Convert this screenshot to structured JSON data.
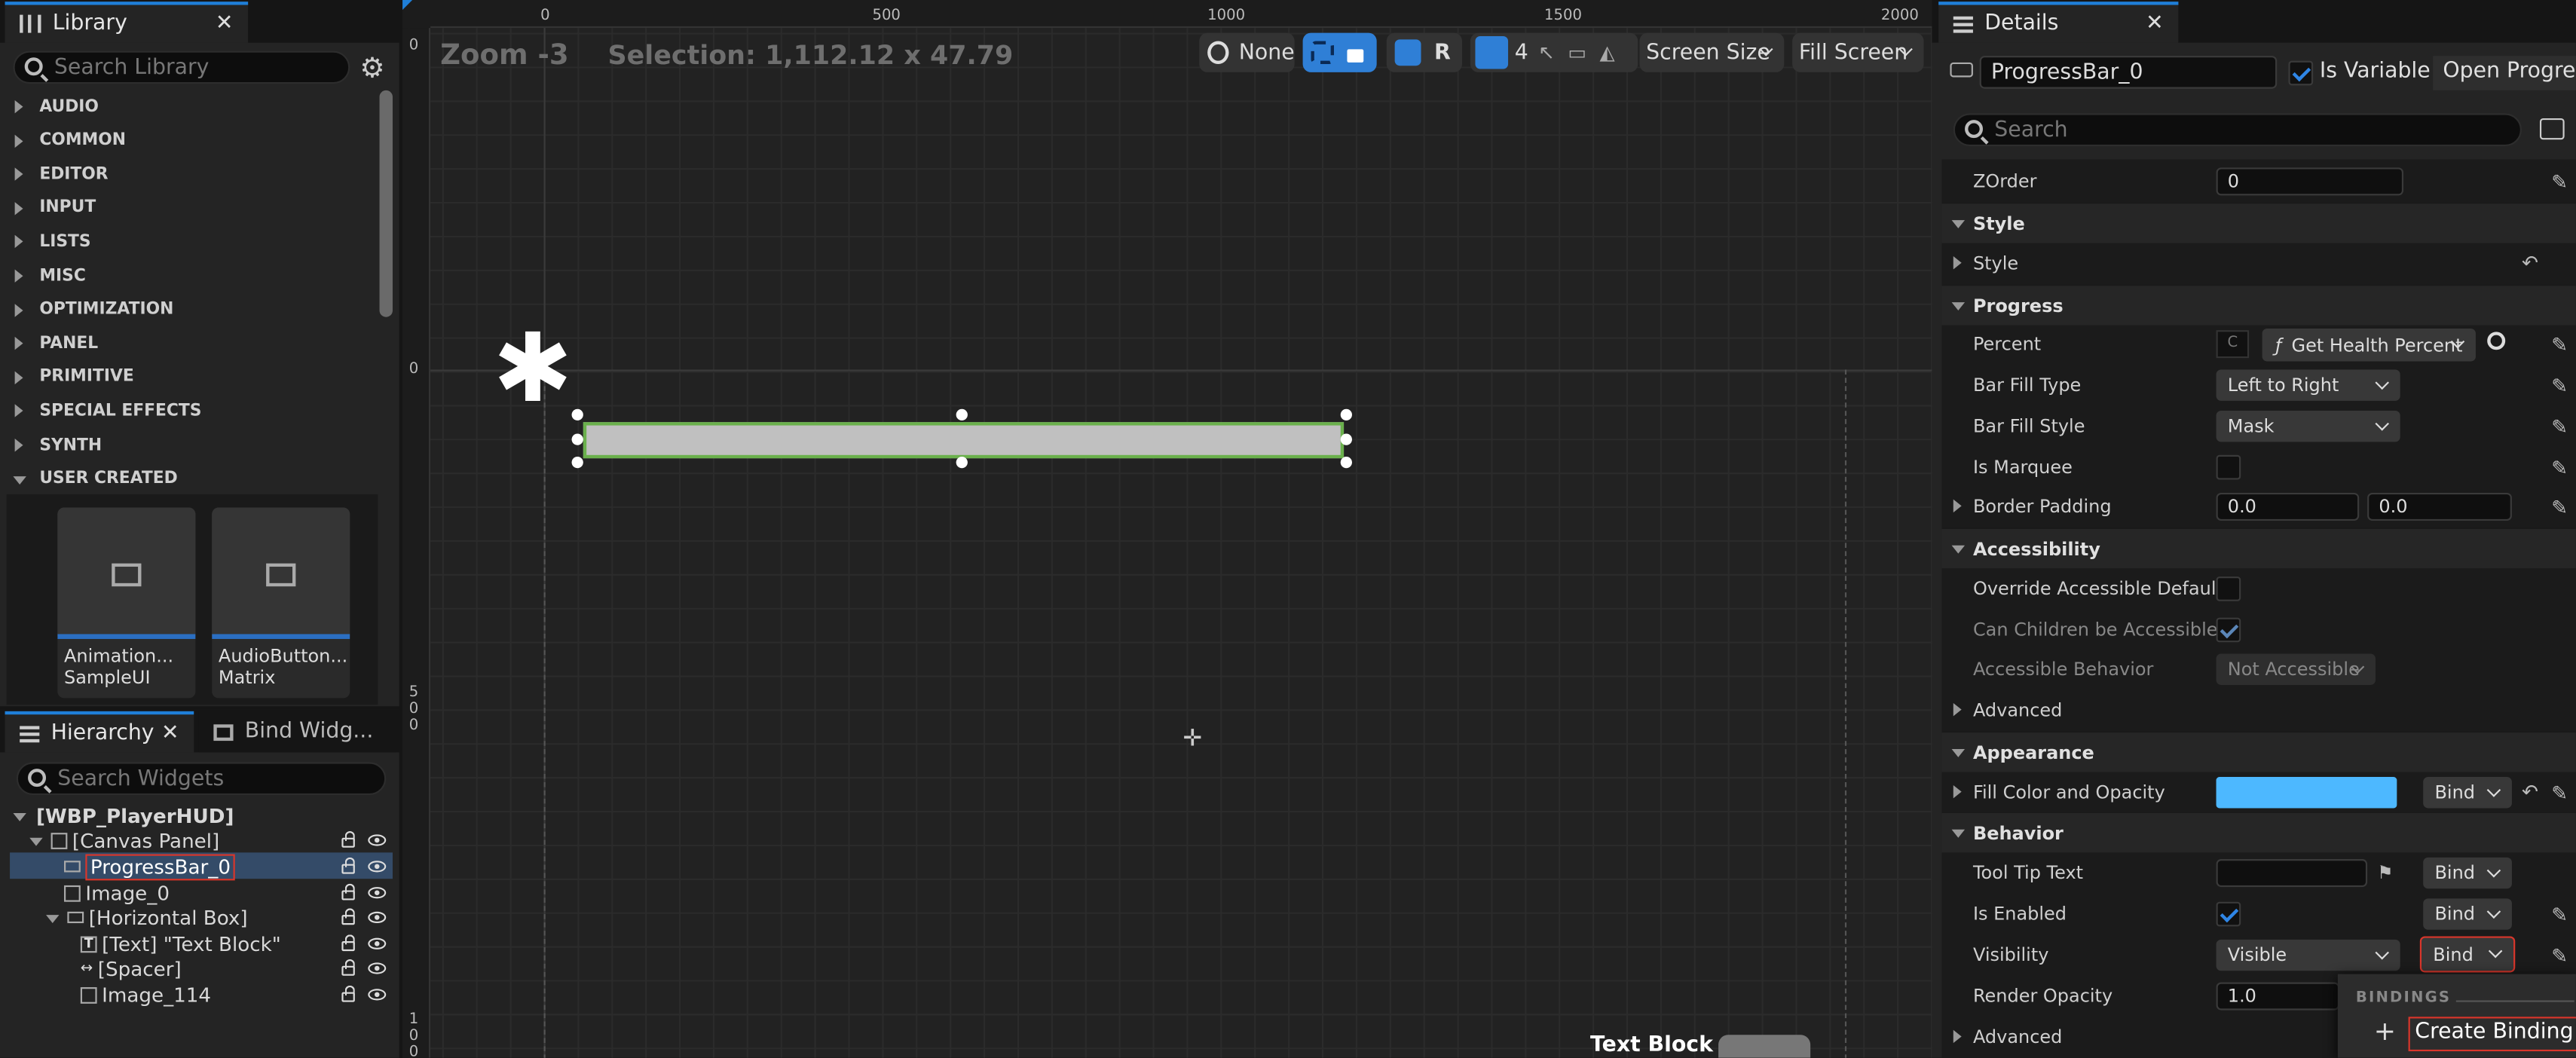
{
  "library": {
    "tab_title": "Library",
    "search_placeholder": "Search Library",
    "categories": [
      "AUDIO",
      "COMMON",
      "EDITOR",
      "INPUT",
      "LISTS",
      "MISC",
      "OPTIMIZATION",
      "PANEL",
      "PRIMITIVE",
      "SPECIAL EFFECTS",
      "SYNTH",
      "USER CREATED"
    ],
    "tiles": [
      {
        "line1": "Animation...",
        "line2": "SampleUI"
      },
      {
        "line1": "AudioButton...",
        "line2": "Matrix"
      }
    ]
  },
  "hierarchy": {
    "tab_title": "Hierarchy",
    "other_tab": "Bind Widg...",
    "search_placeholder": "Search Widgets",
    "items": [
      {
        "label": "[WBP_PlayerHUD]"
      },
      {
        "label": "[Canvas Panel]"
      },
      {
        "label": "ProgressBar_0"
      },
      {
        "label": "Image_0"
      },
      {
        "label": "[Horizontal Box]"
      },
      {
        "label": "[Text] \"Text Block\""
      },
      {
        "label": "[Spacer]"
      },
      {
        "label": "Image_114"
      }
    ]
  },
  "viewport": {
    "zoom": "Zoom -3",
    "selection": "Selection: 1,112.12 x 47.79",
    "toolbar": {
      "none": "None",
      "r": "R",
      "grid_count": "4",
      "screen_size": "Screen Size",
      "fill_screen": "Fill Screen"
    },
    "ruler_top": [
      "0",
      "500",
      "1000",
      "1500",
      "2000"
    ],
    "ruler_left_0": "0",
    "ruler_left_0b": "0",
    "ruler_left_500": [
      "5",
      "0",
      "0"
    ],
    "ruler_left_1000": [
      "1",
      "0",
      "0"
    ],
    "text_block": "Text Block"
  },
  "details": {
    "tab_title": "Details",
    "name": "ProgressBar_0",
    "is_variable": "Is Variable",
    "open_button": "Open Progress",
    "search_placeholder": "Search",
    "zorder_label": "ZOrder",
    "zorder_value": "0",
    "style_section": "Style",
    "style_label": "Style",
    "progress_section": "Progress",
    "percent_label": "Percent",
    "percent_binding": "Get Health Percent",
    "bar_fill_type_label": "Bar Fill Type",
    "bar_fill_type_value": "Left to Right",
    "bar_fill_style_label": "Bar Fill Style",
    "bar_fill_style_value": "Mask",
    "is_marquee_label": "Is Marquee",
    "border_padding_label": "Border Padding",
    "border_padding_x": "0.0",
    "border_padding_y": "0.0",
    "accessibility_section": "Accessibility",
    "override_label": "Override Accessible Defaults",
    "can_children_label": "Can Children be Accessible",
    "accessible_behavior_label": "Accessible Behavior",
    "accessible_behavior_value": "Not Accessible",
    "advanced_label": "Advanced",
    "appearance_section": "Appearance",
    "fill_color_label": "Fill Color and Opacity",
    "fill_color": "#4db8ff",
    "behavior_section": "Behavior",
    "tooltip_label": "Tool Tip Text",
    "is_enabled_label": "Is Enabled",
    "visibility_label": "Visibility",
    "visibility_value": "Visible",
    "render_opacity_label": "Render Opacity",
    "render_opacity_value": "1.0",
    "bind_label": "Bind",
    "bindings_header": "BINDINGS",
    "create_binding": "Create Binding"
  },
  "colors": {
    "accent": "#1f7fd8",
    "highlight_red": "#d9362b",
    "selection_green": "#6ab04c"
  }
}
